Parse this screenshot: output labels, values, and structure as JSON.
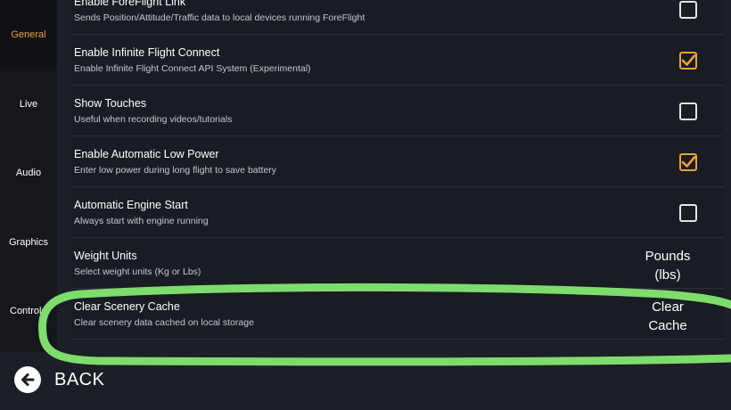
{
  "sidebar": {
    "tabs": [
      {
        "label": "General",
        "active": true
      },
      {
        "label": "Live",
        "active": false
      },
      {
        "label": "Audio",
        "active": false
      },
      {
        "label": "Graphics",
        "active": false
      },
      {
        "label": "Controls",
        "active": false
      }
    ]
  },
  "settings": [
    {
      "title": "Enable ForeFlight Link",
      "subtitle": "Sends Position/Attitude/Traffic data to local devices running ForeFlight",
      "control": "checkbox",
      "checked": false
    },
    {
      "title": "Enable Infinite Flight Connect",
      "subtitle": "Enable Infinite Flight Connect API System (Experimental)",
      "control": "checkbox",
      "checked": true
    },
    {
      "title": "Show Touches",
      "subtitle": "Useful when recording videos/tutorials",
      "control": "checkbox",
      "checked": false
    },
    {
      "title": "Enable Automatic Low Power",
      "subtitle": "Enter low power during long flight to save battery",
      "control": "checkbox",
      "checked": true
    },
    {
      "title": "Automatic Engine Start",
      "subtitle": "Always start with engine running",
      "control": "checkbox",
      "checked": false
    },
    {
      "title": "Weight Units",
      "subtitle": "Select weight units (Kg or Lbs)",
      "control": "button",
      "value_line1": "Pounds",
      "value_line2": "(lbs)"
    },
    {
      "title": "Clear Scenery Cache",
      "subtitle": "Clear scenery data cached on local storage",
      "control": "button",
      "value_line1": "Clear",
      "value_line2": "Cache"
    }
  ],
  "footer": {
    "back_label": "BACK"
  },
  "colors": {
    "accent": "#e8a33a",
    "highlight_marker": "#7ddc6c",
    "background": "#1c1f26"
  }
}
